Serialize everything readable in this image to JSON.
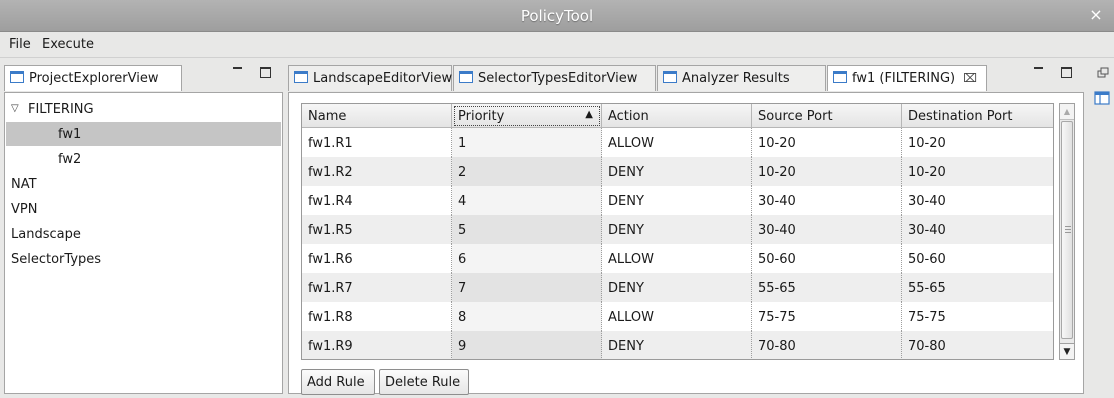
{
  "window": {
    "title": "PolicyTool",
    "close_label": "×"
  },
  "menu": [
    {
      "label": "File"
    },
    {
      "label": "Execute"
    }
  ],
  "left": {
    "tab_label": "ProjectExplorerView",
    "tree": [
      {
        "label": "FILTERING",
        "level": 0,
        "expanded": true
      },
      {
        "label": "fw1",
        "level": 1,
        "selected": true
      },
      {
        "label": "fw2",
        "level": 1
      },
      {
        "label": "NAT",
        "level": 0
      },
      {
        "label": "VPN",
        "level": 0
      },
      {
        "label": "Landscape",
        "level": 0
      },
      {
        "label": "SelectorTypes",
        "level": 0
      }
    ]
  },
  "editor": {
    "tabs": [
      {
        "label": "LandscapeEditorView"
      },
      {
        "label": "SelectorTypesEditorView"
      },
      {
        "label": "Analyzer Results"
      },
      {
        "label": "fw1 (FILTERING)",
        "active": true,
        "close": "⌧"
      }
    ],
    "table": {
      "columns": [
        "Name",
        "Priority",
        "Action",
        "Source Port",
        "Destination Port"
      ],
      "sorted_column": "Priority",
      "sort_direction": "ascending",
      "rows": [
        [
          "fw1.R1",
          "1",
          "ALLOW",
          "10-20",
          "10-20"
        ],
        [
          "fw1.R2",
          "2",
          "DENY",
          "10-20",
          "10-20"
        ],
        [
          "fw1.R4",
          "4",
          "DENY",
          "30-40",
          "30-40"
        ],
        [
          "fw1.R5",
          "5",
          "DENY",
          "30-40",
          "30-40"
        ],
        [
          "fw1.R6",
          "6",
          "ALLOW",
          "50-60",
          "50-60"
        ],
        [
          "fw1.R7",
          "7",
          "DENY",
          "55-65",
          "55-65"
        ],
        [
          "fw1.R8",
          "8",
          "ALLOW",
          "75-75",
          "75-75"
        ],
        [
          "fw1.R9",
          "9",
          "DENY",
          "70-80",
          "70-80"
        ]
      ]
    },
    "buttons": {
      "add": "Add Rule",
      "delete": "Delete Rule"
    }
  },
  "icons": {
    "view": "view-tab-icon",
    "minimize": "minimize-icon",
    "maximize": "maximize-icon",
    "restore": "restore-icon",
    "layout": "layout-icon"
  },
  "colors": {
    "selection": "#c5c5c5",
    "tab_icon": "#3b7bc8",
    "titlebar": "#a8a8a8"
  }
}
